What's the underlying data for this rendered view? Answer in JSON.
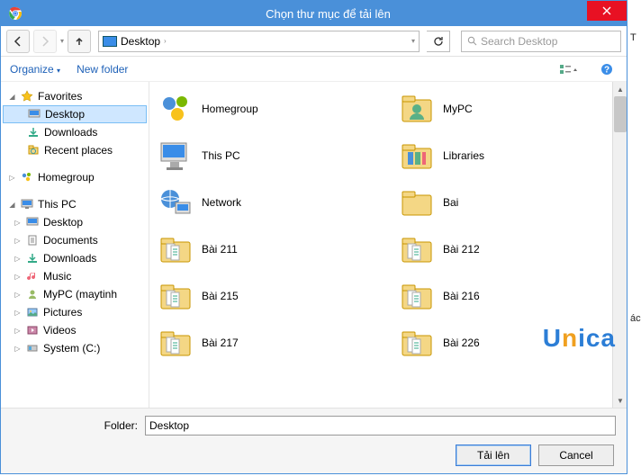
{
  "titlebar": {
    "title": "Chọn thư mục để tải lên"
  },
  "nav": {
    "breadcrumb": "Desktop",
    "search_placeholder": "Search Desktop"
  },
  "toolbar": {
    "organize": "Organize",
    "newfolder": "New folder"
  },
  "sidebar": {
    "favorites": "Favorites",
    "fav_items": [
      {
        "label": "Desktop",
        "selected": true
      },
      {
        "label": "Downloads",
        "selected": false
      },
      {
        "label": "Recent places",
        "selected": false
      }
    ],
    "homegroup": "Homegroup",
    "thispc": "This PC",
    "pc_items": [
      {
        "label": "Desktop"
      },
      {
        "label": "Documents"
      },
      {
        "label": "Downloads"
      },
      {
        "label": "Music"
      },
      {
        "label": "MyPC (maytinh"
      },
      {
        "label": "Pictures"
      },
      {
        "label": "Videos"
      },
      {
        "label": "System (C:)"
      }
    ]
  },
  "items": {
    "left": [
      {
        "label": "Homegroup",
        "kind": "homegroup"
      },
      {
        "label": "This PC",
        "kind": "pc"
      },
      {
        "label": "Network",
        "kind": "network"
      },
      {
        "label": "Bài 211",
        "kind": "folder-docs"
      },
      {
        "label": "Bài 215",
        "kind": "folder-docs"
      },
      {
        "label": "Bài 217",
        "kind": "folder-docs"
      }
    ],
    "right": [
      {
        "label": "MyPC",
        "kind": "user"
      },
      {
        "label": "Libraries",
        "kind": "libraries"
      },
      {
        "label": "Bai",
        "kind": "folder"
      },
      {
        "label": "Bài 212",
        "kind": "folder-docs"
      },
      {
        "label": "Bài 216",
        "kind": "folder-docs"
      },
      {
        "label": "Bài 226",
        "kind": "folder-docs"
      }
    ]
  },
  "footer": {
    "folder_label": "Folder:",
    "folder_value": "Desktop",
    "upload": "Tải lên",
    "cancel": "Cancel"
  },
  "rightedge": {
    "t1": "T",
    "t2": "ác"
  }
}
